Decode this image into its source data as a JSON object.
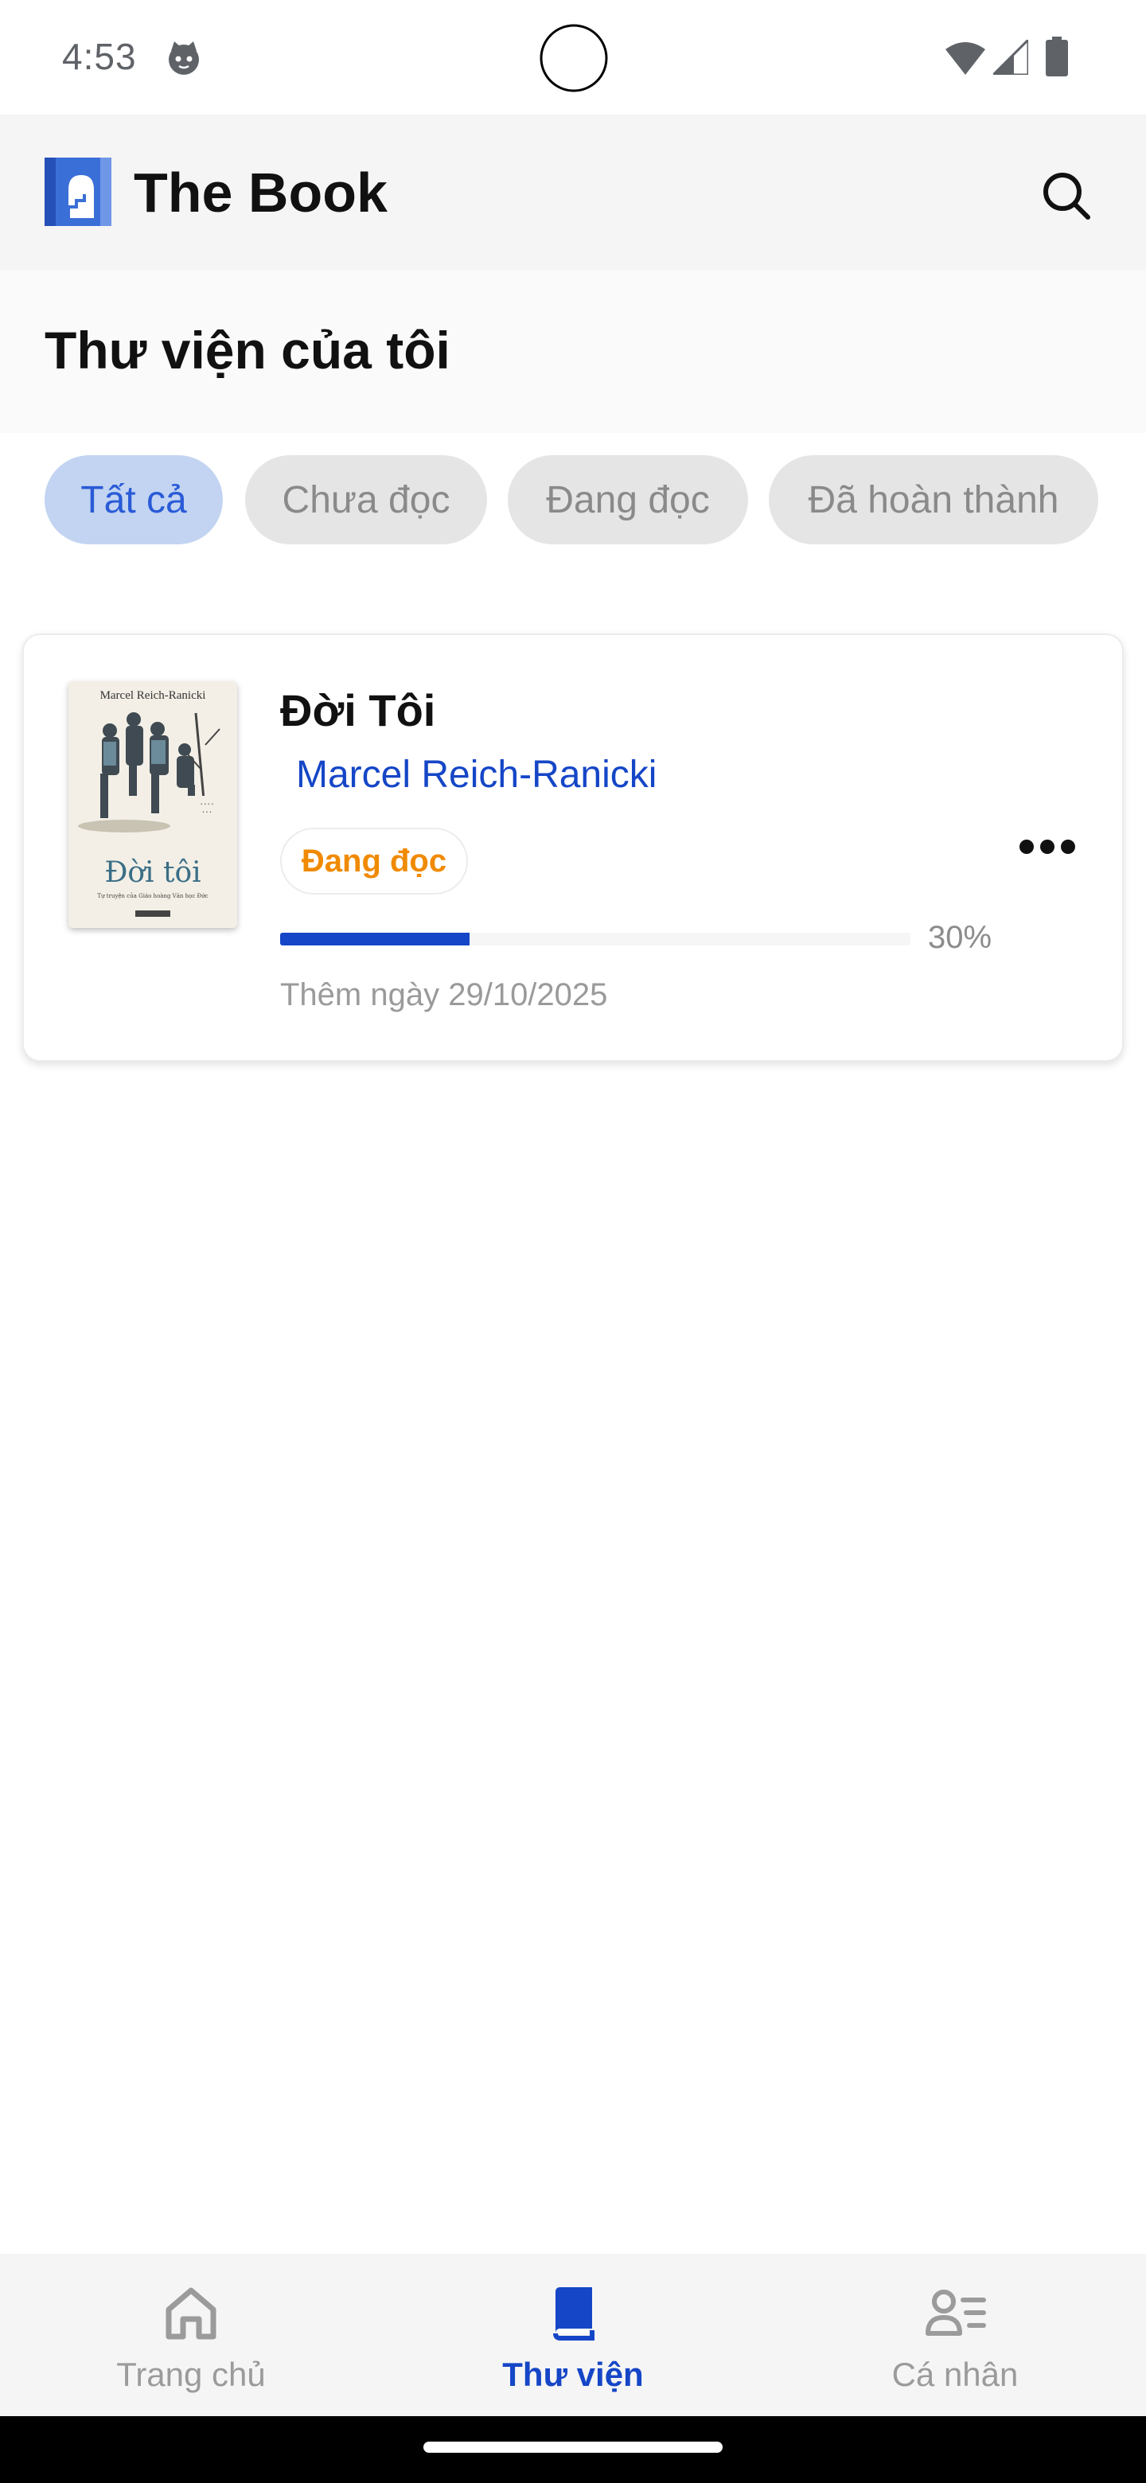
{
  "status_bar": {
    "time": "4:53",
    "app_icon": "cat-face-icon",
    "wifi_icon": "wifi-icon",
    "signal_icon": "cell-signal-icon",
    "battery_icon": "battery-icon"
  },
  "app_bar": {
    "title": "The Book",
    "logo_icon": "book-logo-icon",
    "search_icon": "search-icon"
  },
  "page": {
    "title": "Thư viện của tôi"
  },
  "filters": [
    {
      "label": "Tất cả",
      "active": true
    },
    {
      "label": "Chưa đọc",
      "active": false
    },
    {
      "label": "Đang đọc",
      "active": false
    },
    {
      "label": "Đã hoàn thành",
      "active": false
    }
  ],
  "books": [
    {
      "title": "Đời Tôi",
      "author": "Marcel Reich-Ranicki",
      "status": "Đang đọc",
      "progress_percent": 30,
      "progress_label": "30%",
      "added_label": "Thêm ngày 29/10/2025",
      "cover": {
        "author_text": "Marcel Reich-Ranicki",
        "title_text": "Đời tôi",
        "subtitle_text": "Tự truyện của Giáo hoàng Văn học Đức"
      }
    }
  ],
  "bottom_nav": [
    {
      "label": "Trang chủ",
      "icon": "home-icon",
      "active": false
    },
    {
      "label": "Thư viện",
      "icon": "book-icon",
      "active": true
    },
    {
      "label": "Cá nhân",
      "icon": "profile-list-icon",
      "active": false
    }
  ],
  "colors": {
    "accent": "#1546c7",
    "chip_active_bg": "#c2d4f1",
    "chip_bg": "#e5e5e5",
    "status_reading": "#f08a00"
  }
}
